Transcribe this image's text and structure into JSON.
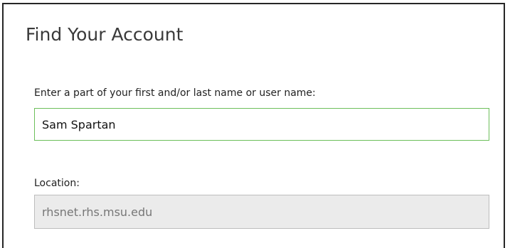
{
  "form": {
    "title": "Find Your Account",
    "name_label": "Enter a part of your first and/or last name or user name:",
    "name_value": "Sam Spartan",
    "location_label": "Location:",
    "location_value": "rhsnet.rhs.msu.edu"
  },
  "colors": {
    "active_field_border": "#6cbf5a",
    "disabled_field_bg": "#ebebeb"
  }
}
